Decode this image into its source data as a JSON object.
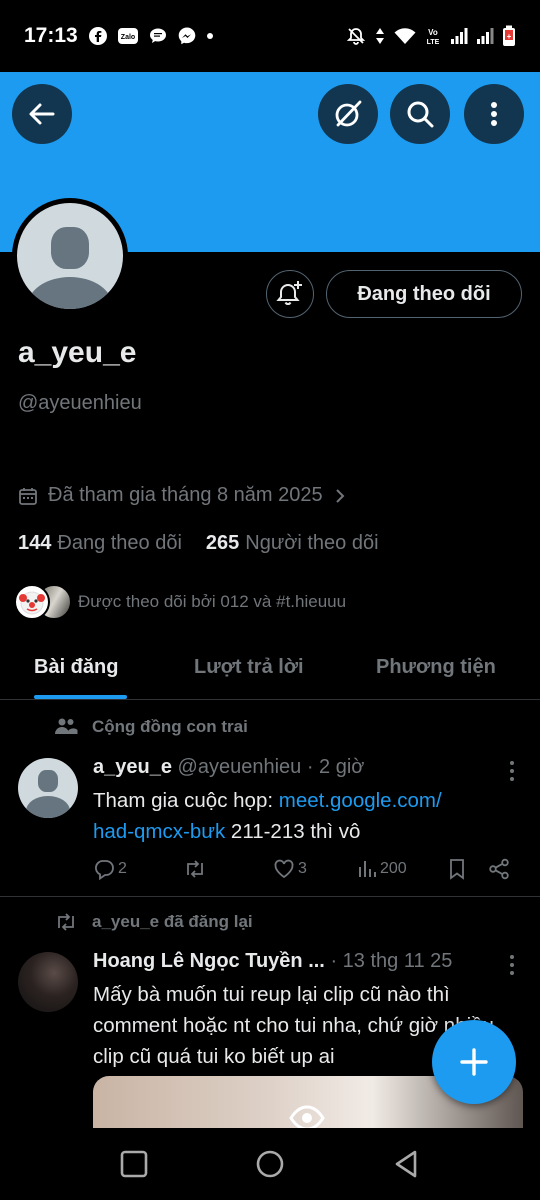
{
  "status_bar": {
    "time": "17:13",
    "left_icons": [
      "facebook-icon",
      "zalo-icon",
      "chat-bubble-icon",
      "messenger-icon",
      "dot-icon"
    ],
    "right_icons": [
      "bell-off-icon",
      "data-arrows-icon",
      "wifi-icon",
      "volte-icon",
      "signal-icon",
      "signal-icon",
      "battery-low-icon"
    ],
    "volte_label": "Vo LTE"
  },
  "toolbar": {
    "back_icon": "arrow-left-icon",
    "grok_icon": "grok-icon",
    "search_icon": "search-icon",
    "more_icon": "more-vertical-icon"
  },
  "profile": {
    "display_name": "a_yeu_e",
    "handle": "@ayeuenhieu",
    "joined": "Đã tham gia tháng 8 năm 2025",
    "following_count": "144",
    "following_label": "Đang theo dõi",
    "followers_count": "265",
    "followers_label": "Người theo dõi",
    "followed_by": "Được theo dõi bởi 012 và #t.hieuuu",
    "follow_button": "Đang theo dõi",
    "colors": {
      "banner": "#1d9bf0",
      "accent": "#1d9bf0"
    }
  },
  "tabs": [
    {
      "label": "Bài đăng",
      "active": true
    },
    {
      "label": "Lượt trả lời",
      "active": false
    },
    {
      "label": "Phương tiện",
      "active": false
    }
  ],
  "posts": [
    {
      "context": "Cộng đồng con trai",
      "context_icon": "community-icon",
      "author": "a_yeu_e",
      "handle": "@ayeuenhieu",
      "time": "· 2 giờ",
      "text_before": "Tham gia cuộc họp: ",
      "link_1": "meet.google.com/",
      "link_2": "had-qmcx-bưk",
      "text_after": " 211-213 thì vô",
      "replies": "2",
      "reposts": "",
      "likes": "3",
      "views": "200"
    },
    {
      "context": "a_yeu_e đã đăng lại",
      "context_icon": "repost-icon",
      "author": "Hoang Lê Ngọc Tuyền ...",
      "time": "· 13 thg 11 25",
      "text": "Mấy bà muốn tui reup lại clip cũ nào thì comment hoặc nt cho tui nha, chứ giờ nhiều clip cũ quá tui ko biết up ai"
    }
  ],
  "fab_icon": "plus-icon",
  "nav": [
    "recents-square-icon",
    "home-circle-icon",
    "back-triangle-icon"
  ]
}
